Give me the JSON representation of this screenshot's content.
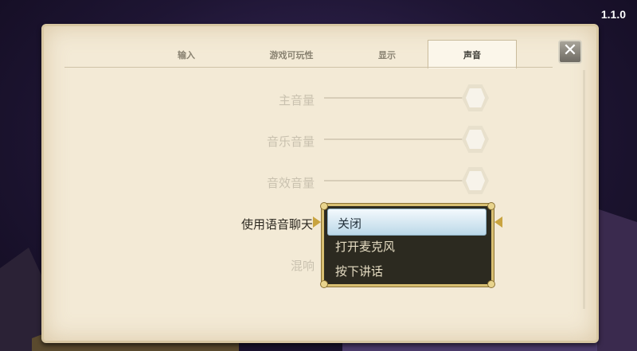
{
  "version": "1.1.0",
  "tabs": [
    {
      "label": "输入",
      "active": false
    },
    {
      "label": "游戏可玩性",
      "active": false
    },
    {
      "label": "显示",
      "active": false
    },
    {
      "label": "声音",
      "active": true
    }
  ],
  "sliders": [
    {
      "label": "主音量",
      "disabled": true
    },
    {
      "label": "音乐音量",
      "disabled": true
    },
    {
      "label": "音效音量",
      "disabled": true
    }
  ],
  "voice_chat": {
    "label": "使用语音聊天",
    "options": [
      "关闭",
      "打开麦克风",
      "按下讲话"
    ],
    "selected": "关闭"
  },
  "reverb_label": "混响",
  "colors": {
    "panel": "#f3ead6",
    "dropdown_bg": "#2c2a20",
    "dropdown_border": "#d8bf72",
    "selected_bg": "#cfe3ef"
  }
}
